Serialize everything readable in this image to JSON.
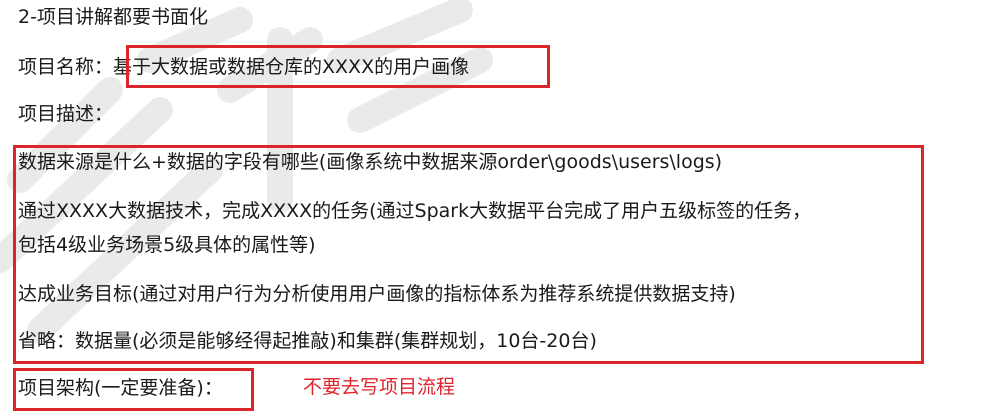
{
  "heading": "2-项目讲解都要书面化",
  "project_name": {
    "label": "项目名称：",
    "value": "基于大数据或数据仓库的XXXX的用户画像"
  },
  "project_desc": {
    "label": "项目描述："
  },
  "desc_lines": [
    "数据来源是什么+数据的字段有哪些(画像系统中数据来源order\\goods\\users\\logs)",
    "通过XXXX大数据技术，完成XXXX的任务(通过Spark大数据平台完成了用户五级标签的任务，",
    "包括4级业务场景5级具体的属性等)",
    "达成业务目标(通过对用户行为分析使用用户画像的指标体系为推荐系统提供数据支持)",
    "省略：数据量(必须是能够经得起推敲)和集群(集群规划，10台-20台)"
  ],
  "project_arch": {
    "label": "项目架构(一定要准备)："
  },
  "note": "不要去写项目流程",
  "colors": {
    "highlight_box": "#d8262c",
    "note_text": "#e0232b",
    "body_text": "#1a1a1a"
  }
}
